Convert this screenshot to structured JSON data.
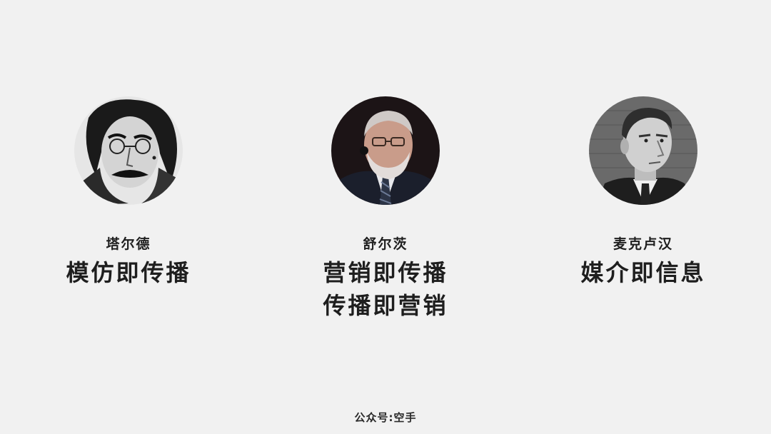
{
  "people": [
    {
      "name": "塔尔德",
      "slogans": [
        "模仿即传播"
      ],
      "portrait": "tarde-portrait"
    },
    {
      "name": "舒尔茨",
      "slogans": [
        "营销即传播",
        "传播即营销"
      ],
      "portrait": "schultz-portrait"
    },
    {
      "name": "麦克卢汉",
      "slogans": [
        "媒介即信息"
      ],
      "portrait": "mcluhan-portrait"
    }
  ],
  "footer": "公众号:空手",
  "colors": {
    "background": "#f1f1f1",
    "text": "#1e1e1e"
  }
}
